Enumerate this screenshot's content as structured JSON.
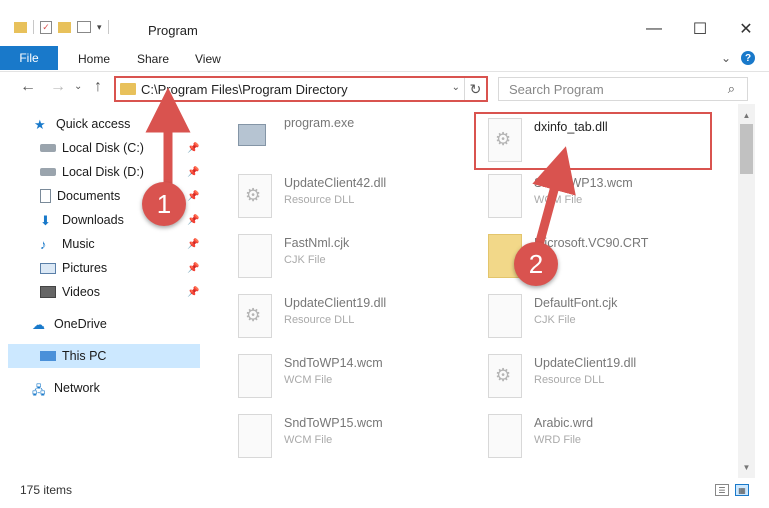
{
  "window": {
    "title": "Program",
    "minimize": "—",
    "maximize": "☐",
    "close": "✕"
  },
  "ribbon": {
    "tabs": [
      "File",
      "Home",
      "Share",
      "View"
    ],
    "expand": "⌄",
    "help": "?"
  },
  "nav": {
    "back": "←",
    "forward": "→",
    "recent": "⌄",
    "up": "↑",
    "address": "C:\\Program Files\\Program Directory",
    "address_dropdown": "⌄",
    "refresh": "↻",
    "search_placeholder": "Search Program",
    "search_icon": "⌕"
  },
  "sidebar": {
    "items": [
      {
        "label": "Quick access",
        "icon": "star-icon",
        "pinned": false
      },
      {
        "label": "Local Disk (C:)",
        "icon": "drive-icon",
        "pinned": true
      },
      {
        "label": "Local Disk (D:)",
        "icon": "drive-icon",
        "pinned": true
      },
      {
        "label": "Documents",
        "icon": "document-icon",
        "pinned": true
      },
      {
        "label": "Downloads",
        "icon": "download-icon",
        "pinned": true
      },
      {
        "label": "Music",
        "icon": "music-icon",
        "pinned": true
      },
      {
        "label": "Pictures",
        "icon": "pictures-icon",
        "pinned": true
      },
      {
        "label": "Videos",
        "icon": "video-icon",
        "pinned": true
      },
      {
        "label": "OneDrive",
        "icon": "cloud-icon",
        "pinned": false
      },
      {
        "label": "This PC",
        "icon": "computer-icon",
        "pinned": false,
        "selected": true
      },
      {
        "label": "Network",
        "icon": "network-icon",
        "pinned": false
      }
    ],
    "pin_glyph": "📌"
  },
  "files": [
    {
      "name": "program.exe",
      "type": ""
    },
    {
      "name": "dxinfo_tab.dll",
      "type": ""
    },
    {
      "name": "UpdateClient42.dll",
      "type": "Resource DLL"
    },
    {
      "name": "SndToWP13.wcm",
      "type": "WCM File"
    },
    {
      "name": "FastNml.cjk",
      "type": "CJK File"
    },
    {
      "name": "Microsoft.VC90.CRT",
      "type": ""
    },
    {
      "name": "UpdateClient19.dll",
      "type": "Resource DLL"
    },
    {
      "name": "DefaultFont.cjk",
      "type": "CJK File"
    },
    {
      "name": "SndToWP14.wcm",
      "type": "WCM File"
    },
    {
      "name": "UpdateClient19.dll",
      "type": "Resource DLL"
    },
    {
      "name": "SndToWP15.wcm",
      "type": "WCM File"
    },
    {
      "name": "Arabic.wrd",
      "type": "WRD File"
    }
  ],
  "status": {
    "count": "175 items"
  },
  "callouts": [
    "1",
    "2"
  ],
  "colors": {
    "accent": "#1979ca",
    "highlight": "#d9534f",
    "selection": "#cce8ff"
  }
}
